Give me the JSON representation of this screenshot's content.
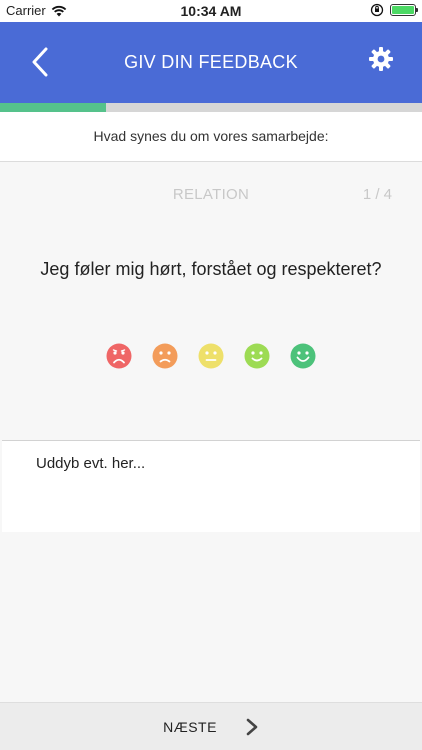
{
  "status_bar": {
    "carrier": "Carrier",
    "time": "10:34 AM"
  },
  "nav": {
    "title": "GIV DIN FEEDBACK",
    "back_icon": "chevron-left-icon",
    "settings_icon": "gear-icon",
    "color": "#4a6bd6"
  },
  "progress": {
    "fraction": 0.25,
    "color": "#55c28b"
  },
  "subtitle": "Hvad synes du om vores samarbejde:",
  "question": {
    "category": "RELATION",
    "counter": "1 / 4",
    "text": "Jeg føler mig hørt, forstået og respekteret?"
  },
  "rating": {
    "options": [
      {
        "icon": "very-sad-face-icon",
        "color": "#ef6666"
      },
      {
        "icon": "sad-face-icon",
        "color": "#f39c5a"
      },
      {
        "icon": "neutral-face-icon",
        "color": "#eee06a"
      },
      {
        "icon": "happy-face-icon",
        "color": "#9ddb54"
      },
      {
        "icon": "very-happy-face-icon",
        "color": "#4cc27a"
      }
    ]
  },
  "comment": {
    "placeholder": "Uddyb evt. her...",
    "value": ""
  },
  "footer": {
    "next_label": "NÆSTE",
    "next_icon": "chevron-right-icon"
  }
}
